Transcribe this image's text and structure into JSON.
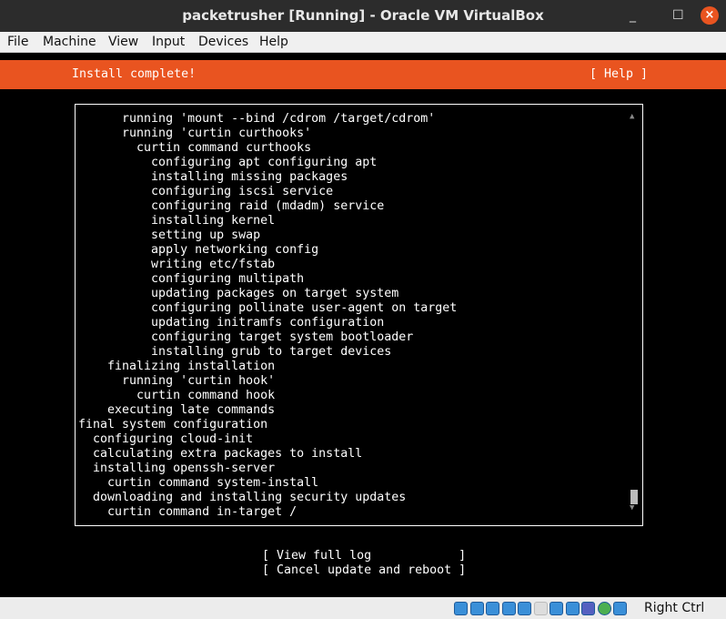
{
  "window": {
    "title": "packetrusher [Running] - Oracle VM VirtualBox",
    "minimize": "_",
    "maximize": "☐",
    "close": "×"
  },
  "menu": [
    "File",
    "Machine",
    "View",
    "Input",
    "Devices",
    "Help"
  ],
  "installer": {
    "header": "Install complete!",
    "help": "[ Help ]",
    "log": [
      "      running 'mount --bind /cdrom /target/cdrom'",
      "      running 'curtin curthooks'",
      "        curtin command curthooks",
      "          configuring apt configuring apt",
      "          installing missing packages",
      "          configuring iscsi service",
      "          configuring raid (mdadm) service",
      "          installing kernel",
      "          setting up swap",
      "          apply networking config",
      "          writing etc/fstab",
      "          configuring multipath",
      "          updating packages on target system",
      "          configuring pollinate user-agent on target",
      "          updating initramfs configuration",
      "          configuring target system bootloader",
      "          installing grub to target devices",
      "    finalizing installation",
      "      running 'curtin hook'",
      "        curtin command hook",
      "    executing late commands",
      "final system configuration",
      "  configuring cloud-init",
      "  calculating extra packages to install",
      "  installing openssh-server",
      "    curtin command system-install",
      "  downloading and installing security updates",
      "    curtin command in-target /"
    ],
    "buttons": [
      "[ View full log            ]",
      "[ Cancel update and reboot ]"
    ]
  },
  "statusbar": {
    "host_key": "Right Ctrl",
    "icons": [
      "hard-disk",
      "optical-drive",
      "audio",
      "network",
      "usb",
      "shared-folders",
      "display",
      "screen-capture",
      "cpu-indicator",
      "mouse-integration",
      "keyboard-capture"
    ]
  }
}
